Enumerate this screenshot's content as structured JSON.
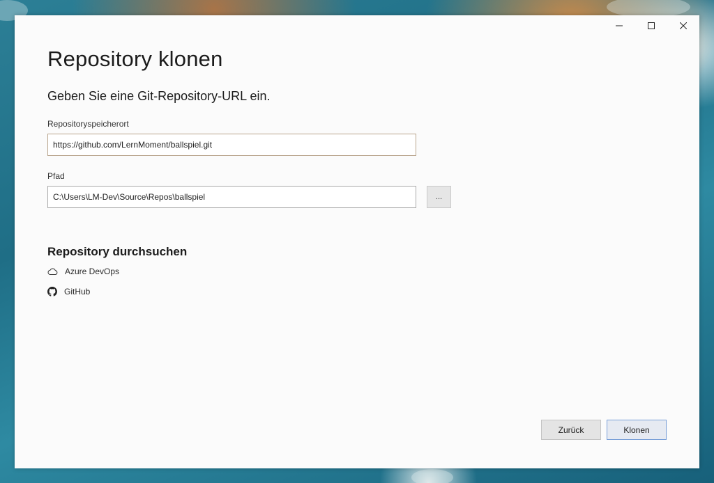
{
  "window": {
    "title": "Repository klonen",
    "subtitle": "Geben Sie eine Git-Repository-URL ein."
  },
  "form": {
    "repo_label": "Repositoryspeicherort",
    "repo_value": "https://github.com/LernMoment/ballspiel.git",
    "path_label": "Pfad",
    "path_value": "C:\\Users\\LM-Dev\\Source\\Repos\\ballspiel",
    "browse_label": "..."
  },
  "browse": {
    "title": "Repository durchsuchen",
    "items": [
      {
        "label": "Azure DevOps",
        "icon": "cloud-icon"
      },
      {
        "label": "GitHub",
        "icon": "github-icon"
      }
    ]
  },
  "footer": {
    "back_label": "Zurück",
    "clone_label": "Klonen"
  }
}
